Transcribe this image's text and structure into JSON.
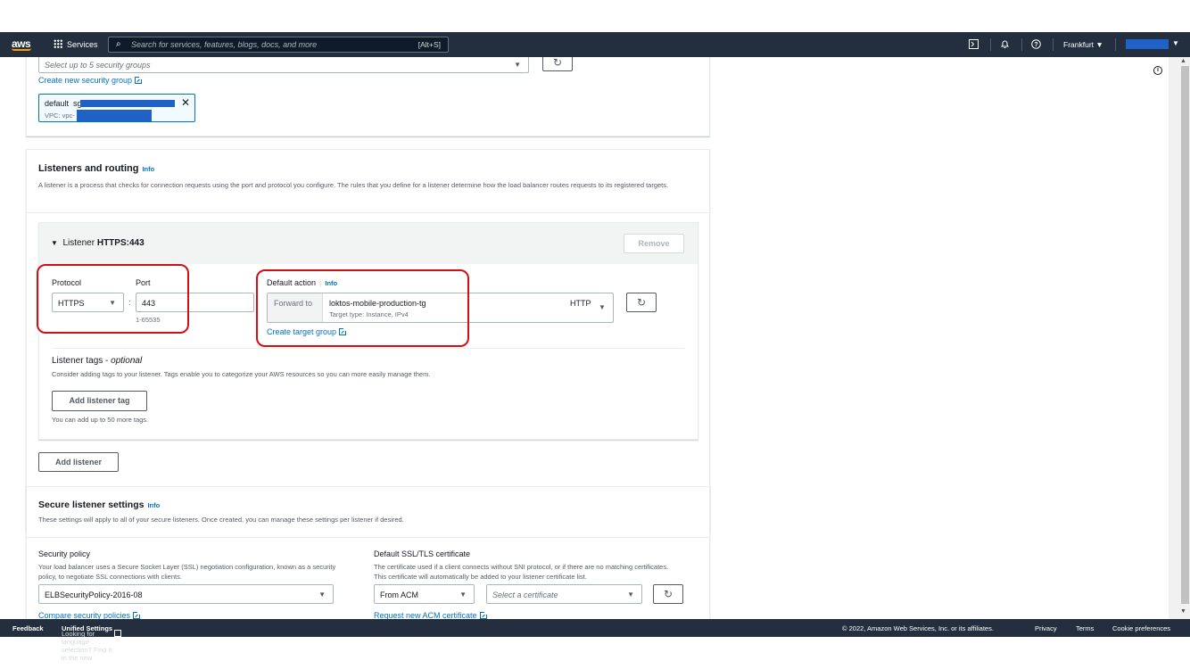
{
  "nav": {
    "logo": "aws",
    "services": "Services",
    "search_placeholder": "Search for services, features, blogs, docs, and more",
    "search_shortcut": "[Alt+S]",
    "region": "Frankfurt ▼",
    "account_caret": "▼"
  },
  "security_groups": {
    "select_placeholder": "Select up to 5 security groups",
    "create_link": "Create new security group",
    "token_name": "default",
    "token_sg_prefix": "sg-",
    "token_vpc_prefix": "VPC: vpc-"
  },
  "listeners": {
    "title": "Listeners and routing",
    "info": "Info",
    "description": "A listener is a process that checks for connection requests using the port and protocol you configure. The rules that you define for a listener determine how the load balancer routes requests to its registered targets.",
    "listener_title_prefix": "Listener",
    "listener_title": "HTTPS:443",
    "remove_button": "Remove",
    "protocol_label": "Protocol",
    "protocol_value": "HTTPS",
    "port_label": "Port",
    "port_value": "443",
    "port_hint": "1-65535",
    "default_action_label": "Default action",
    "default_action_info": "Info",
    "forward_to": "Forward to",
    "target_group": "loktos-mobile-production-tg",
    "target_type": "Target type: Instance, IPv4",
    "target_protocol": "HTTP",
    "create_target_group": "Create target group",
    "tags_title": "Listener tags - ",
    "tags_optional": "optional",
    "tags_description": "Consider adding tags to your listener. Tags enable you to categorize your AWS resources so you can more easily manage them.",
    "add_tag_button": "Add listener tag",
    "tags_hint": "You can add up to 50 more tags.",
    "add_listener_button": "Add listener"
  },
  "secure": {
    "title": "Secure listener settings",
    "info": "Info",
    "description": "These settings will apply to all of your secure listeners. Once created, you can manage these settings per listener if desired.",
    "policy_label": "Security policy",
    "policy_desc": "Your load balancer uses a Secure Socket Layer (SSL) negotiation configuration, known as a security policy, to negotiate SSL connections with clients.",
    "policy_value": "ELBSecurityPolicy-2016-08",
    "compare_link": "Compare security policies",
    "cert_label": "Default SSL/TLS certificate",
    "cert_desc": "The certificate used if a client connects without SNI protocol, or if there are no matching certificates. This certificate will automatically be added to your listener certificate list.",
    "cert_source": "From ACM",
    "cert_placeholder": "Select a certificate",
    "request_link": "Request new ACM certificate"
  },
  "footer": {
    "feedback": "Feedback",
    "language_prefix": "Looking for language selection? Find it in the new",
    "unified_settings": "Unified Settings",
    "copyright": "© 2022, Amazon Web Services, Inc. or its affiliates.",
    "privacy": "Privacy",
    "terms": "Terms",
    "cookies": "Cookie preferences"
  },
  "colors": {
    "nav_bg": "#232f3e",
    "link": "#0073bb",
    "highlight": "#d40f14",
    "redaction": "#1f61c6"
  }
}
